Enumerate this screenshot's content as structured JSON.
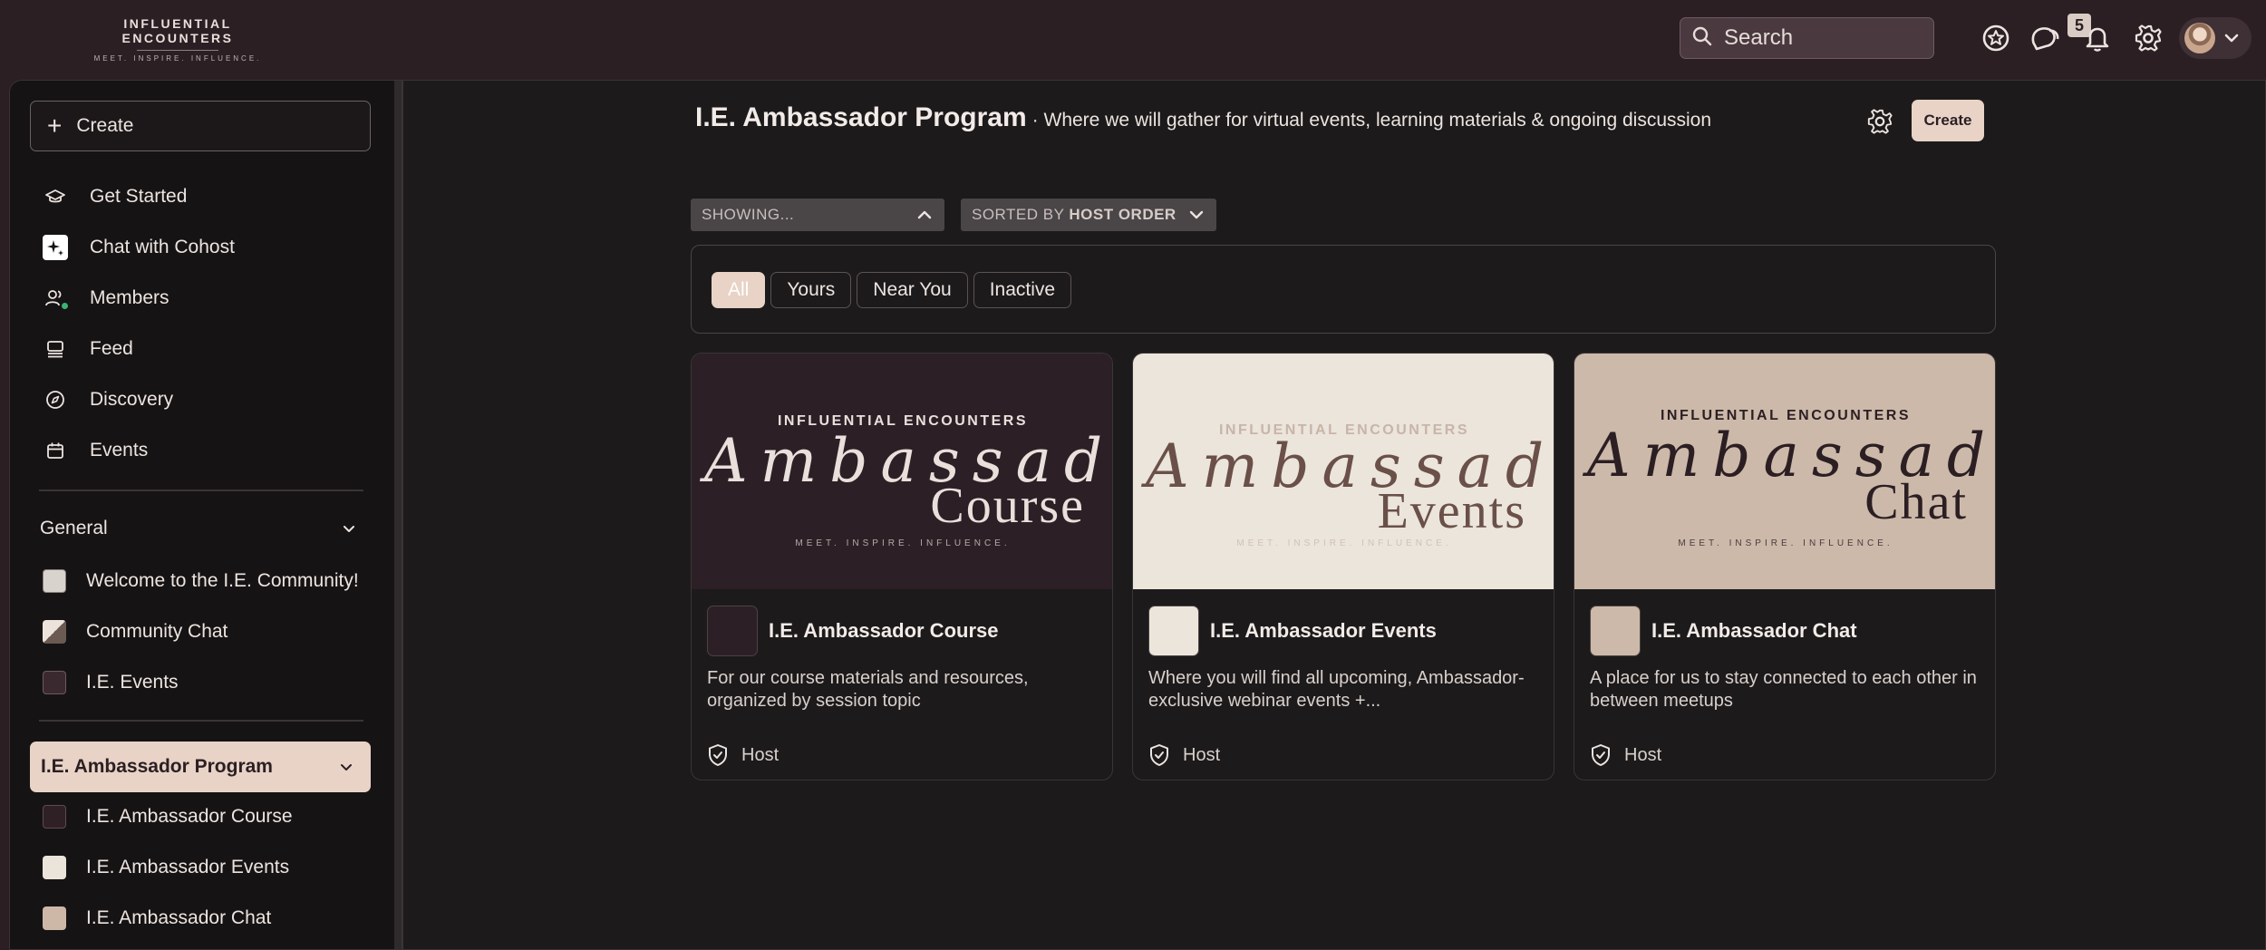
{
  "topbar": {
    "brand": "INFLUENTIAL ENCOUNTERS",
    "tagline": "MEET. INSPIRE. INFLUENCE.",
    "search_label": "Search",
    "notification_count": "5"
  },
  "sidebar": {
    "create_label": "Create",
    "nav": [
      {
        "label": "Get Started",
        "icon": "graduation-cap-icon"
      },
      {
        "label": "Chat with Cohost",
        "icon": "sparkle-icon"
      },
      {
        "label": "Members",
        "icon": "people-icon"
      },
      {
        "label": "Feed",
        "icon": "feed-icon"
      },
      {
        "label": "Discovery",
        "icon": "compass-icon"
      },
      {
        "label": "Events",
        "icon": "calendar-icon"
      }
    ],
    "general": {
      "label": "General",
      "items": [
        {
          "label": "Welcome to the I.E. Community!"
        },
        {
          "label": "Community Chat"
        },
        {
          "label": "I.E. Events"
        }
      ]
    },
    "program": {
      "label": "I.E. Ambassador Program",
      "items": [
        {
          "label": "I.E. Ambassador Course"
        },
        {
          "label": "I.E. Ambassador Events"
        },
        {
          "label": "I.E. Ambassador Chat"
        }
      ]
    }
  },
  "main": {
    "title": "I.E. Ambassador Program",
    "subtitle": "· Where we will gather for virtual events, learning materials & ongoing discussion",
    "create_label": "Create",
    "showing_label": "SHOWING...",
    "sorted_prefix": "SORTED BY",
    "sorted_value": "HOST ORDER",
    "filters": [
      "All",
      "Yours",
      "Near You",
      "Inactive"
    ],
    "cards": [
      {
        "title": "I.E. Ambassador Course",
        "description": "For our course materials and resources, organized by session topic",
        "role": "Host",
        "banner_brand": "INFLUENTIAL ENCOUNTERS",
        "banner_script": "Ambassador",
        "banner_word": "Course",
        "banner_tag": "MEET. INSPIRE. INFLUENCE."
      },
      {
        "title": "I.E. Ambassador Events",
        "description": "Where you will find all upcoming, Ambassador-exclusive webinar events +...",
        "role": "Host",
        "banner_brand": "INFLUENTIAL ENCOUNTERS",
        "banner_script": "Ambassador",
        "banner_word": "Events",
        "banner_tag": "MEET. INSPIRE. INFLUENCE."
      },
      {
        "title": "I.E. Ambassador Chat",
        "description": "A place for us to stay connected to each other in between meetups",
        "role": "Host",
        "banner_brand": "INFLUENTIAL ENCOUNTERS",
        "banner_script": "Ambassador",
        "banner_word": "Chat",
        "banner_tag": "MEET. INSPIRE. INFLUENCE."
      }
    ]
  },
  "colors": {
    "topbar_bg": "#2b1f24",
    "accent": "#e8d3c6",
    "main_bg": "#1c1a1b",
    "sidebar_bg": "#161314"
  }
}
